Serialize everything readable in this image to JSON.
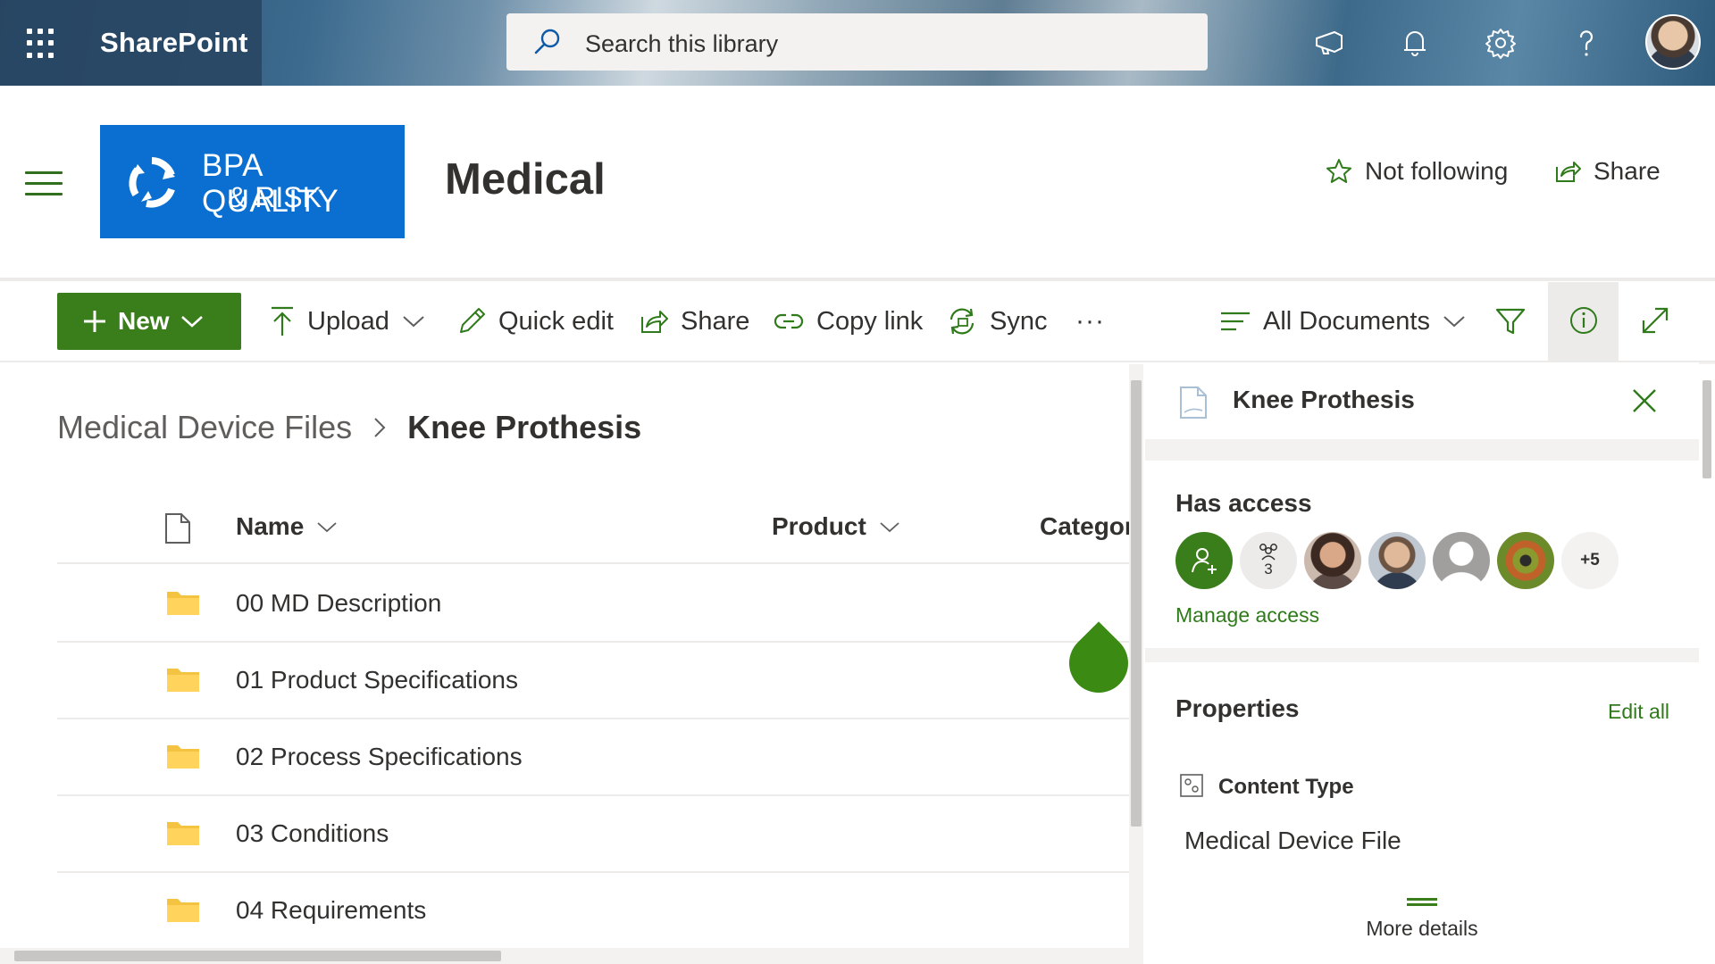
{
  "suite": {
    "app_name": "SharePoint",
    "search_placeholder": "Search this library",
    "icons": [
      "waffle-icon",
      "megaphone-icon",
      "bell-icon",
      "gear-icon",
      "help-icon"
    ]
  },
  "site": {
    "logo_line1": "BPA QUALITY",
    "logo_line2": "& RISK",
    "title": "Medical",
    "follow_label": "Not following",
    "share_label": "Share"
  },
  "commands": {
    "new": "New",
    "upload": "Upload",
    "quick_edit": "Quick edit",
    "share": "Share",
    "copy_link": "Copy link",
    "sync": "Sync",
    "more": "···",
    "view": "All Documents"
  },
  "breadcrumb": {
    "parent": "Medical Device Files",
    "current": "Knee Prothesis"
  },
  "columns": {
    "name": "Name",
    "product": "Product",
    "category": "Categor"
  },
  "rows": [
    {
      "name": "00 MD Description"
    },
    {
      "name": "01 Product Specifications"
    },
    {
      "name": "02 Process Specifications"
    },
    {
      "name": "03 Conditions"
    },
    {
      "name": "04 Requirements"
    }
  ],
  "details": {
    "title": "Knee Prothesis",
    "has_access": "Has access",
    "group_count": "3",
    "more_count": "+5",
    "manage_access": "Manage access",
    "properties": "Properties",
    "edit_all": "Edit all",
    "content_type_label": "Content Type",
    "content_type_value": "Medical Device File",
    "more_details": "More details"
  },
  "colors": {
    "accent_green": "#3a7d1b",
    "logo_blue": "#0a6fd1",
    "folder_yellow": "#f5c342"
  }
}
